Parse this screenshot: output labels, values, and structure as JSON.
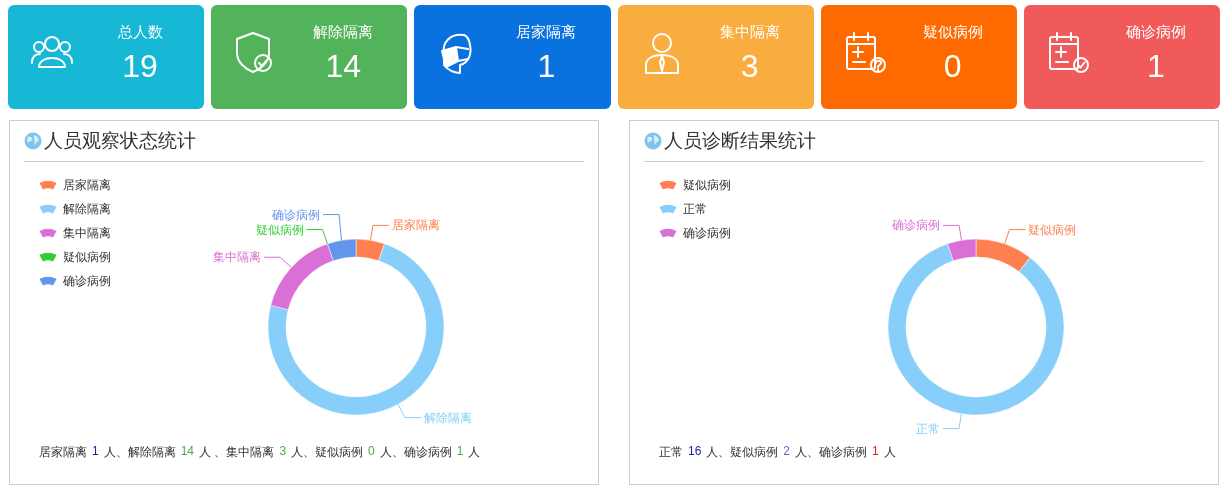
{
  "stat_cards": [
    {
      "label": "总人数",
      "value": "19",
      "color": "#17b8d6"
    },
    {
      "label": "解除隔离",
      "value": "14",
      "color": "#52b35a"
    },
    {
      "label": "居家隔离",
      "value": "1",
      "color": "#0a72de"
    },
    {
      "label": "集中隔离",
      "value": "3",
      "color": "#f9ad3f"
    },
    {
      "label": "疑似病例",
      "value": "0",
      "color": "#ff6a00"
    },
    {
      "label": "确诊病例",
      "value": "1",
      "color": "#f05a5a"
    }
  ],
  "panels": [
    {
      "title": "人员观察状态统计",
      "legend": [
        {
          "label": "居家隔离",
          "color": "#ff7f50"
        },
        {
          "label": "解除隔离",
          "color": "#87cefa"
        },
        {
          "label": "集中隔离",
          "color": "#da70d6"
        },
        {
          "label": "疑似病例",
          "color": "#32cd32"
        },
        {
          "label": "确诊病例",
          "color": "#6495ed"
        }
      ],
      "chart_data": {
        "type": "donut",
        "categories": [
          "居家隔离",
          "解除隔离",
          "集中隔离",
          "疑似病例",
          "确诊病例"
        ],
        "values": [
          5.26,
          73.69,
          15.79,
          0,
          5.26
        ]
      },
      "summary": [
        {
          "label": "居家隔离",
          "count": "1",
          "color": "#1c1ca8",
          "suffix": "人、"
        },
        {
          "label": "解除隔离",
          "count": "14",
          "color": "#4caa4c",
          "suffix": "人 、"
        },
        {
          "label": "集中隔离",
          "count": "3",
          "color": "#4caa4c",
          "suffix": "人、"
        },
        {
          "label": "疑似病例",
          "count": "0",
          "color": "#4caa4c",
          "suffix": "人、"
        },
        {
          "label": "确诊病例",
          "count": "1",
          "color": "#4caa4c",
          "suffix": "人"
        }
      ]
    },
    {
      "title": "人员诊断结果统计",
      "legend": [
        {
          "label": "疑似病例",
          "color": "#ff7f50"
        },
        {
          "label": "正常",
          "color": "#87cefa"
        },
        {
          "label": "确诊病例",
          "color": "#da70d6"
        }
      ],
      "chart_data": {
        "type": "donut",
        "categories": [
          "疑似病例",
          "正常",
          "确诊病例"
        ],
        "values": [
          10.53,
          84.21,
          5.26
        ]
      },
      "summary": [
        {
          "label": "正常",
          "count": "16",
          "color": "#1c1ca8",
          "suffix": "人、"
        },
        {
          "label": "疑似病例",
          "count": "2",
          "color": "#7b59c8",
          "suffix": "人、"
        },
        {
          "label": "确诊病例",
          "count": "1",
          "color": "#e02020",
          "suffix": "人"
        }
      ]
    }
  ]
}
